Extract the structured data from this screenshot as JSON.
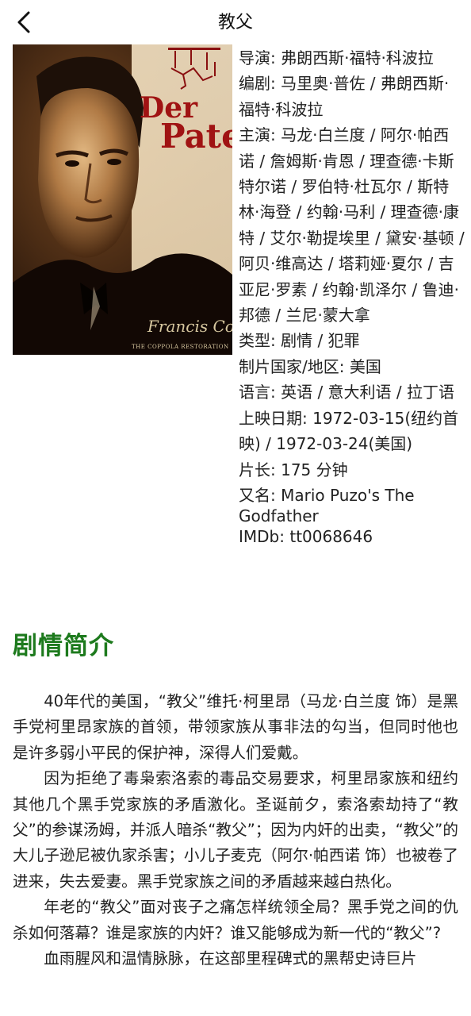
{
  "header": {
    "title": "教父",
    "back_icon": "chevron-left-icon"
  },
  "poster": {
    "title_line1": "Der",
    "title_line2": "Pate",
    "signature": "Francis Coppola",
    "subtitle": "THE COPPOLA RESTORATION"
  },
  "info": {
    "director": "导演: 弗朗西斯·福特·科波拉",
    "writer": "编剧: 马里奥·普佐 / 弗朗西斯·福特·科波拉",
    "cast": "主演: 马龙·白兰度 / 阿尔·帕西诺 / 詹姆斯·肯恩 / 理查德·卡斯特尔诺 / 罗伯特·杜瓦尔 / 斯特林·海登 / 约翰·马利 / 理查德·康特 / 艾尔·勒提埃里 / 黛安·基顿 / 阿贝·维高达 / 塔莉娅·夏尔 / 吉亚尼·罗素 / 约翰·凯泽尔 / 鲁迪·邦德 / 兰尼·蒙大拿",
    "genre": "类型: 剧情 / 犯罪",
    "country": "制片国家/地区: 美国",
    "language": "语言: 英语 / 意大利语 / 拉丁语",
    "release": "上映日期: 1972-03-15(纽约首映) / 1972-03-24(美国)",
    "runtime": "片长: 175 分钟",
    "aka": "又名: Mario Puzo's The Godfather",
    "imdb": "IMDb: tt0068646"
  },
  "synopsis": {
    "heading": "剧情简介",
    "paragraphs": [
      "40年代的美国，“教父”维托·柯里昂（马龙·白兰度 饰）是黑手党柯里昂家族的首领，带领家族从事非法的勾当，但同时他也是许多弱小平民的保护神，深得人们爱戴。",
      "因为拒绝了毒枭索洛索的毒品交易要求，柯里昂家族和纽约其他几个黑手党家族的矛盾激化。圣诞前夕，索洛索劫持了“教父”的参谋汤姆，并派人暗杀“教父”；因为内奸的出卖，“教父”的大儿子逊尼被仇家杀害；小儿子麦克（阿尔·帕西诺 饰）也被卷了进来，失去爱妻。黑手党家族之间的矛盾越来越白热化。",
      "年老的“教父”面对丧子之痛怎样统领全局？黑手党之间的仇杀如何落幕？谁是家族的内奸？谁又能够成为新一代的“教父”?",
      "血雨腥风和温情脉脉，在这部里程碑式的黑帮史诗巨片"
    ]
  }
}
